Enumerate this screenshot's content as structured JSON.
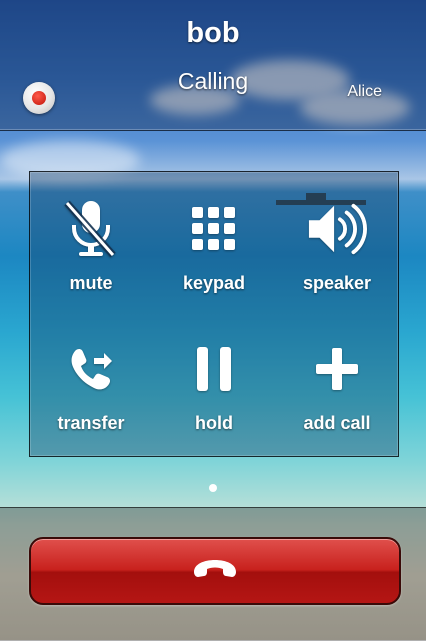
{
  "call": {
    "caller_name": "bob",
    "status": "Calling",
    "account": "Alice"
  },
  "icons": {
    "record": "record-icon",
    "mute": "microphone-slash-icon",
    "keypad": "keypad-icon",
    "speaker": "speaker-icon",
    "transfer": "phone-transfer-icon",
    "hold": "pause-icon",
    "add_call": "plus-icon",
    "end_call": "phone-hangup-icon"
  },
  "controls": {
    "mute": "mute",
    "keypad": "keypad",
    "speaker": "speaker",
    "transfer": "transfer",
    "hold": "hold",
    "add_call": "add call"
  },
  "pager": {
    "pages": 1,
    "current": 1
  },
  "colors": {
    "end_call": "#c8211d",
    "record": "#d3231a"
  }
}
